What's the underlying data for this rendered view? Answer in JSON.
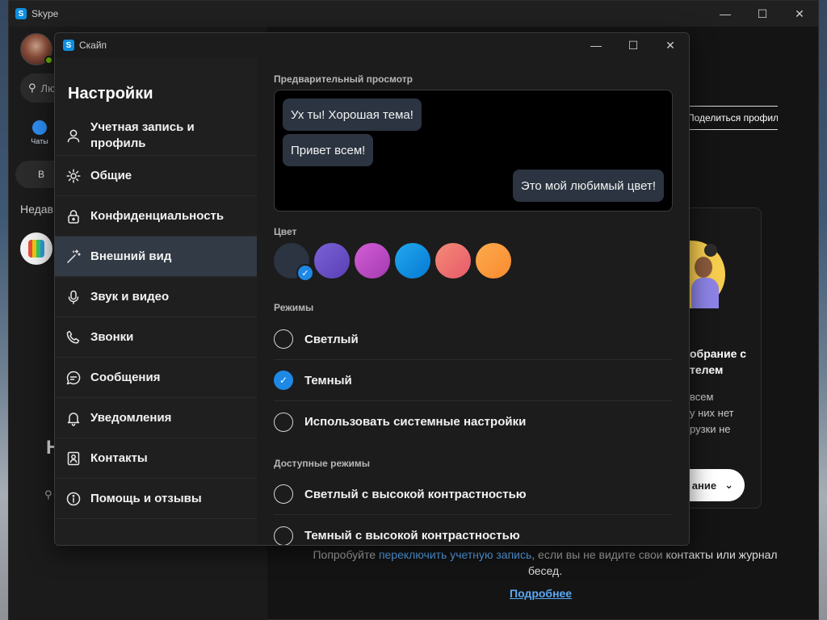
{
  "main_window": {
    "title": "Skype",
    "search_placeholder": "Лю",
    "chats_tab_label": "Чаты",
    "meet_label": "В",
    "recent_label": "Недав",
    "big_letter": "Н",
    "share_profile_label": "Поделиться профилем",
    "promo": {
      "title": "обрание с\nтелем",
      "text": "всем\nу них нет\nрузки не",
      "button_label": "ание"
    },
    "bottom_note": {
      "before": "Попробуйте ",
      "link": "переключить учетную запись",
      "middle": ", если вы не видите свои ",
      "contacts": "контакты",
      "after": " или журнал бесед."
    },
    "more_link": "Подробнее"
  },
  "dialog": {
    "title": "Скайп",
    "nav_title": "Настройки",
    "nav_items": [
      {
        "label": "Учетная запись и профиль",
        "icon": "person-icon"
      },
      {
        "label": "Общие",
        "icon": "gear-icon"
      },
      {
        "label": "Конфиденциальность",
        "icon": "lock-icon"
      },
      {
        "label": "Внешний вид",
        "icon": "magic-wand-icon",
        "active": true
      },
      {
        "label": "Звук и видео",
        "icon": "microphone-icon"
      },
      {
        "label": "Звонки",
        "icon": "phone-icon"
      },
      {
        "label": "Сообщения",
        "icon": "message-icon"
      },
      {
        "label": "Уведомления",
        "icon": "bell-icon"
      },
      {
        "label": "Контакты",
        "icon": "contacts-icon"
      },
      {
        "label": "Помощь и отзывы",
        "icon": "info-icon"
      }
    ],
    "preview": {
      "label": "Предварительный просмотр",
      "messages": [
        "Ух ты! Хорошая тема!",
        "Привет всем!",
        "Это мой любимый цвет!"
      ]
    },
    "color": {
      "label": "Цвет",
      "swatches": [
        "#2b3440",
        "#6a4fc8",
        "#c450c8",
        "#0a96e8",
        "#f06e6e",
        "#fc9a3c"
      ],
      "selected_index": 0,
      "accent": "#1e88e5"
    },
    "modes": {
      "label": "Режимы",
      "options": [
        "Светлый",
        "Темный",
        "Использовать системные настройки"
      ],
      "selected_index": 1
    },
    "available_modes": {
      "label": "Доступные режимы",
      "options": [
        "Светлый с высокой контрастностью",
        "Темный с высокой контрастностью"
      ]
    }
  }
}
